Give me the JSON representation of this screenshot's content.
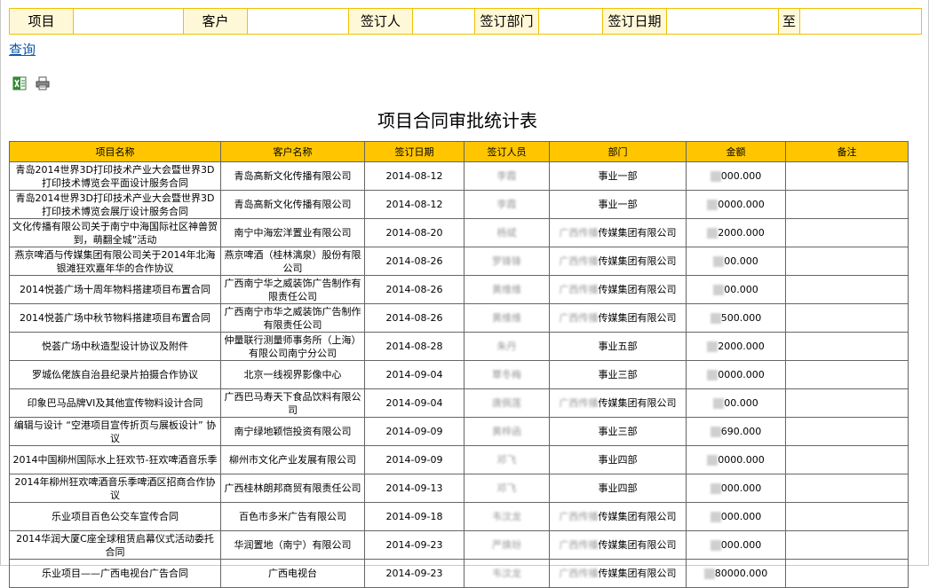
{
  "search": {
    "fields": [
      {
        "label": "项目",
        "value": ""
      },
      {
        "label": "客户",
        "value": ""
      },
      {
        "label": "签订人",
        "value": ""
      },
      {
        "label": "签订部门",
        "value": ""
      },
      {
        "label": "签订日期",
        "value": ""
      },
      {
        "label": "至",
        "value": ""
      }
    ]
  },
  "query_link": "查询",
  "toolbar": {
    "excel_icon": "excel-icon",
    "print_icon": "printer-icon"
  },
  "report": {
    "title": "项目合同审批统计表"
  },
  "table": {
    "headers": [
      "项目名称",
      "客户名称",
      "签订日期",
      "签订人员",
      "部门",
      "金额",
      "备注"
    ],
    "rows": [
      {
        "project": "青岛2014世界3D打印技术产业大会暨世界3D打印技术博览会平面设计服务合同",
        "customer": "青岛高新文化传播有限公司",
        "date": "2014-08-12",
        "person": "李霞",
        "dept": "事业一部",
        "amount": "000.000",
        "note": ""
      },
      {
        "project": "青岛2014世界3D打印技术产业大会暨世界3D打印技术博览会展厅设计服务合同",
        "customer": "青岛高新文化传播有限公司",
        "date": "2014-08-12",
        "person": "李霞",
        "dept": "事业一部",
        "amount": "0000.000",
        "note": ""
      },
      {
        "project": "文化传播有限公司关于南宁中海国际社区神兽贺到，萌翻全城”活动",
        "customer": "南宁中海宏洋置业有限公司",
        "date": "2014-08-20",
        "person": "杨斌",
        "dept": "传媒集团有限公司",
        "amount": "2000.000",
        "note": ""
      },
      {
        "project": "燕京啤酒与传媒集团有限公司关于2014年北海银滩狂欢嘉年华的合作协议",
        "customer": "燕京啤酒（桂林漓泉）股份有限公司",
        "date": "2014-08-26",
        "person": "罗锋锋",
        "dept": "传媒集团有限公司",
        "amount": "00.000",
        "note": ""
      },
      {
        "project": "2014悦荟广场十周年物料搭建项目布置合同",
        "customer": "广西南宁华之威装饰广告制作有限责任公司",
        "date": "2014-08-26",
        "person": "黄维维",
        "dept": "传媒集团有限公司",
        "amount": "00.000",
        "note": ""
      },
      {
        "project": "2014悦荟广场中秋节物料搭建项目布置合同",
        "customer": "广西南宁市华之威装饰广告制作有限责任公司",
        "date": "2014-08-26",
        "person": "黄维维",
        "dept": "传媒集团有限公司",
        "amount": "500.000",
        "note": ""
      },
      {
        "project": "悦荟广场中秋造型设计协议及附件",
        "customer": "仲量联行测量师事务所（上海）有限公司南宁分公司",
        "date": "2014-08-28",
        "person": "朱丹",
        "dept": "事业五部",
        "amount": "2000.000",
        "note": ""
      },
      {
        "project": "罗城仫佬族自治县纪录片拍摄合作协议",
        "customer": "北京一线视界影像中心",
        "date": "2014-09-04",
        "person": "覃冬梅",
        "dept": "事业三部",
        "amount": "0000.000",
        "note": ""
      },
      {
        "project": "印象巴马品牌VI及其他宣传物料设计合同",
        "customer": "广西巴马寿天下食品饮料有限公司",
        "date": "2014-09-04",
        "person": "唐佩莲",
        "dept": "传媒集团有限公司",
        "amount": "00.000",
        "note": ""
      },
      {
        "project": "编辑与设计 “空港项目宣传折页与展板设计” 协议",
        "customer": "南宁绿地颖恺投资有限公司",
        "date": "2014-09-09",
        "person": "黄梓函",
        "dept": "事业三部",
        "amount": "690.000",
        "note": ""
      },
      {
        "project": "2014中国柳州国际水上狂欢节-狂欢啤酒音乐季",
        "customer": "柳州市文化产业发展有限公司",
        "date": "2014-09-09",
        "person": "邓飞",
        "dept": "事业四部",
        "amount": "0000.000",
        "note": ""
      },
      {
        "project": "2014年柳州狂欢啤酒音乐季啤酒区招商合作协议",
        "customer": "广西桂林朗邦商贸有限责任公司",
        "date": "2014-09-13",
        "person": "邓飞",
        "dept": "事业四部",
        "amount": "000.000",
        "note": ""
      },
      {
        "project": "乐业项目百色公交车宣传合同",
        "customer": "百色市多米广告有限公司",
        "date": "2014-09-18",
        "person": "韦汶龙",
        "dept": "传媒集团有限公司",
        "amount": "000.000",
        "note": ""
      },
      {
        "project": "2014华润大厦C座全球租赁启幕仪式活动委托合同",
        "customer": "华润置地（南宁）有限公司",
        "date": "2014-09-23",
        "person": "严焕玢",
        "dept": "传媒集团有限公司",
        "amount": "000.000",
        "note": ""
      },
      {
        "project": "乐业项目——广西电视台广告合同",
        "customer": "广西电视台",
        "date": "2014-09-23",
        "person": "韦汶龙",
        "dept": "传媒集团有限公司",
        "amount": "80000.000",
        "note": ""
      }
    ]
  }
}
